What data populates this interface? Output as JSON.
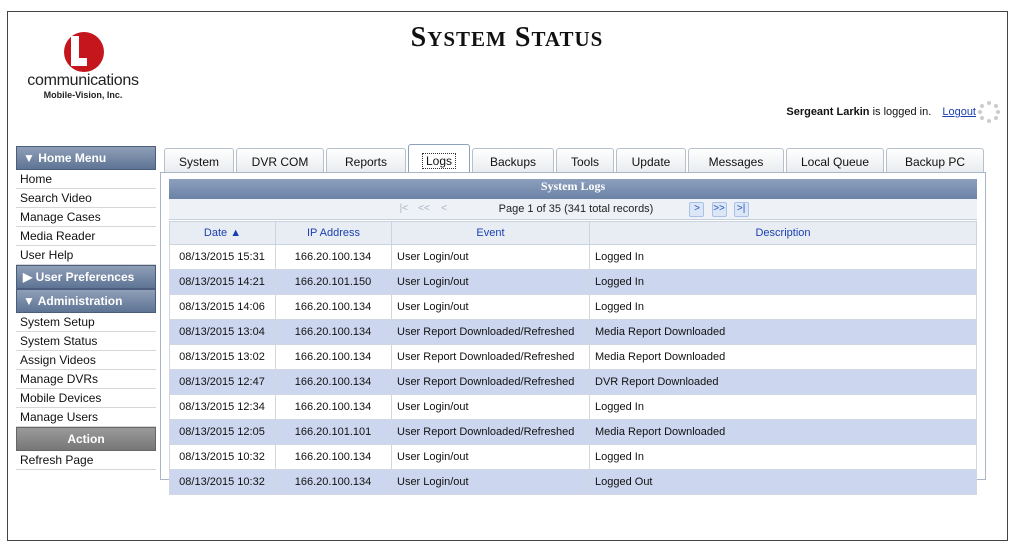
{
  "header": {
    "title_big_1": "S",
    "title_small_1": "YSTEM",
    "title_big_2": "S",
    "title_small_2": "TATUS",
    "logo_line1": "communications",
    "logo_line2": "Mobile-Vision, Inc.",
    "logged_in_user": "Sergeant Larkin",
    "logged_in_suffix": "is logged in.",
    "logout_label": "Logout"
  },
  "sidebar": {
    "home_menu": {
      "title": "▼  Home Menu",
      "items": [
        "Home",
        "Search Video",
        "Manage Cases",
        "Media Reader",
        "User Help"
      ]
    },
    "user_prefs": {
      "title": "▶  User Preferences"
    },
    "administration": {
      "title": "▼  Administration",
      "items": [
        "System Setup",
        "System Status",
        "Assign Videos",
        "Manage DVRs",
        "Mobile Devices",
        "Manage Users"
      ]
    },
    "action": {
      "title": "Action",
      "items": [
        "Refresh Page"
      ]
    }
  },
  "tabs": [
    "System",
    "DVR COM",
    "Reports",
    "Logs",
    "Backups",
    "Tools",
    "Update",
    "Messages",
    "Local Queue",
    "Backup PC"
  ],
  "active_tab": "Logs",
  "grid": {
    "title": "System Logs",
    "pager_text": "Page 1 of 35 (341 total records)",
    "columns": [
      "Date ▲",
      "IP Address",
      "Event",
      "Description"
    ],
    "rows": [
      [
        "08/13/2015 15:31",
        "166.20.100.134",
        "User Login/out",
        "Logged In"
      ],
      [
        "08/13/2015 14:21",
        "166.20.101.150",
        "User Login/out",
        "Logged In"
      ],
      [
        "08/13/2015 14:06",
        "166.20.100.134",
        "User Login/out",
        "Logged In"
      ],
      [
        "08/13/2015 13:04",
        "166.20.100.134",
        "User Report Downloaded/Refreshed",
        "Media Report Downloaded"
      ],
      [
        "08/13/2015 13:02",
        "166.20.100.134",
        "User Report Downloaded/Refreshed",
        "Media Report Downloaded"
      ],
      [
        "08/13/2015 12:47",
        "166.20.100.134",
        "User Report Downloaded/Refreshed",
        "DVR Report Downloaded"
      ],
      [
        "08/13/2015 12:34",
        "166.20.100.134",
        "User Login/out",
        "Logged In"
      ],
      [
        "08/13/2015 12:05",
        "166.20.101.101",
        "User Report Downloaded/Refreshed",
        "Media Report Downloaded"
      ],
      [
        "08/13/2015 10:32",
        "166.20.100.134",
        "User Login/out",
        "Logged In"
      ],
      [
        "08/13/2015 10:32",
        "166.20.100.134",
        "User Login/out",
        "Logged Out"
      ]
    ]
  }
}
